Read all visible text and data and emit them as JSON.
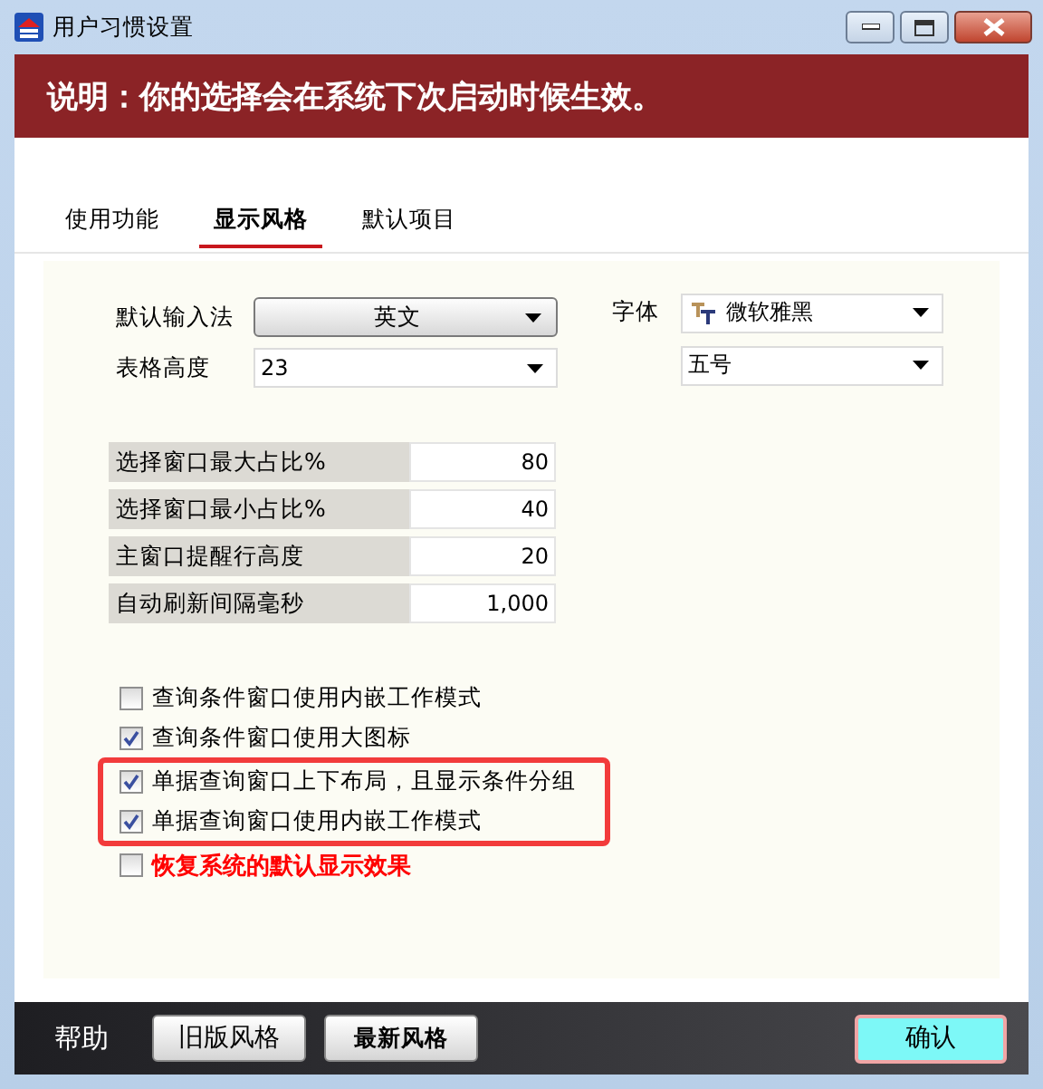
{
  "window": {
    "title": "用户习惯设置"
  },
  "notice": "说明：你的选择会在系统下次启动时候生效。",
  "tabs": [
    {
      "label": "使用功能",
      "selected": false
    },
    {
      "label": "显示风格",
      "selected": true
    },
    {
      "label": "默认项目",
      "selected": false
    }
  ],
  "input_method": {
    "label": "默认输入法",
    "value": "英文"
  },
  "row_height": {
    "label": "表格高度",
    "value": "23"
  },
  "font": {
    "label": "字体",
    "value": "微软雅黑",
    "size": "五号"
  },
  "number_fields": [
    {
      "label": "选择窗口最大占比%",
      "value": "80"
    },
    {
      "label": "选择窗口最小占比%",
      "value": "40"
    },
    {
      "label": "主窗口提醒行高度",
      "value": "20"
    },
    {
      "label": "自动刷新间隔毫秒",
      "value": "1,000"
    }
  ],
  "options": [
    {
      "kind": "option",
      "label": "查询条件窗口使用内嵌工作模式",
      "checked": false,
      "highlighted": false
    },
    {
      "kind": "option",
      "label": "查询条件窗口使用大图标",
      "checked": true,
      "highlighted": false
    },
    {
      "kind": "option",
      "label": "单据查询窗口上下布局，且显示条件分组",
      "checked": true,
      "highlighted": true
    },
    {
      "kind": "option",
      "label": "单据查询窗口使用内嵌工作模式",
      "checked": true,
      "highlighted": true
    },
    {
      "kind": "reset",
      "label": "恢复系统的默认显示效果",
      "checked": false,
      "highlighted": false
    }
  ],
  "footer": {
    "help": "帮助",
    "buttons": [
      {
        "label": "旧版风格",
        "kind": "plain"
      },
      {
        "label": "最新风格",
        "kind": "bold"
      }
    ],
    "confirm": "确认"
  }
}
